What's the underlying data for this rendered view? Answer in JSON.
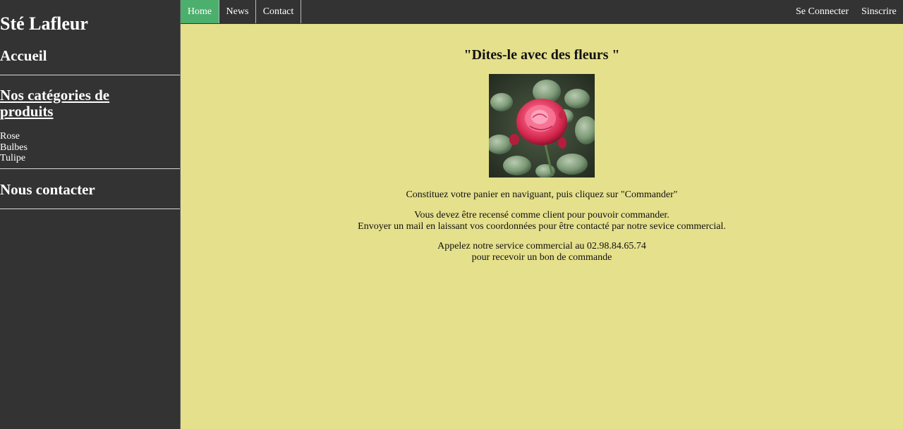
{
  "sidebar": {
    "site_title": "Sté Lafleur",
    "home_label": "Accueil",
    "categories_heading": "Nos catégories de produits",
    "categories": [
      "Rose",
      "Bulbes",
      "Tulipe"
    ],
    "contact_label": "Nous contacter"
  },
  "topbar": {
    "tabs": [
      {
        "label": "Home",
        "active": true
      },
      {
        "label": "News",
        "active": false
      },
      {
        "label": "Contact",
        "active": false
      }
    ],
    "login_label": "Se Connecter",
    "signup_label": "Sinscrire"
  },
  "main": {
    "slogan": "\"Dites-le avec des fleurs \"",
    "image_subject": "red-rose",
    "para1": "Constituez votre panier en naviguant, puis cliquez sur \"Commander\"",
    "para2_line1": "Vous devez être recensé comme client pour pouvoir commander.",
    "para2_line2": "Envoyer un mail en laissant vos coordonnées pour être contacté par notre sevice commercial.",
    "para3_line1": "Appelez notre service commercial au 02.98.84.65.74",
    "para3_line2": "pour recevoir un bon de commande"
  },
  "colors": {
    "sidebar_bg": "#333333",
    "main_bg": "#e5e08c",
    "active_tab": "#4caf6d"
  }
}
